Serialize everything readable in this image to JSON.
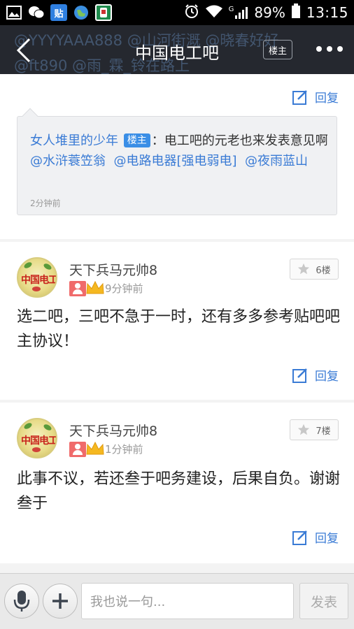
{
  "status_bar": {
    "icons": [
      "gallery-icon",
      "wechat-icon",
      "tieba-icon",
      "globe-icon",
      "app-icon"
    ],
    "tieba_label": "贴",
    "signal_label": "G",
    "battery": "89%",
    "time": "13:15"
  },
  "nav": {
    "title": "中国电工吧",
    "ghost_line1": "@YYYYAAA888  @山河街溉  @晓春好好",
    "ghost_line2": "@ft890  @雨_霖_铃在路上",
    "louzhu_button": "楼主"
  },
  "quote_reply": {
    "reply_label": "回复",
    "username": "女人堆里的少年",
    "tag": "楼主",
    "text_prefix": "：电工吧的元老也来发表意见啊",
    "mention1": "@水浒蓑笠翁",
    "mention2": "@电路电器[强电弱电]",
    "mention3": "@夜雨蓝山",
    "time": "2分钟前"
  },
  "posts": [
    {
      "username": "天下兵马元帅8",
      "time": "9分钟前",
      "floor": "6楼",
      "body": "选二吧，三吧不急于一时，还有多多参考贴吧吧主协议！",
      "reply_label": "回复"
    },
    {
      "username": "天下兵马元帅8",
      "time": "1分钟前",
      "floor": "7楼",
      "body": "此事不议，若还叁于吧务建设，后果自负。谢谢叁于",
      "reply_label": "回复"
    }
  ],
  "avatar_text": "中国电工",
  "bottom": {
    "input_placeholder": "我也说一句...",
    "send_label": "发表"
  },
  "colors": {
    "accent": "#3a7bd5",
    "navbar": "#25282f",
    "tag": "#3a8ee6"
  }
}
